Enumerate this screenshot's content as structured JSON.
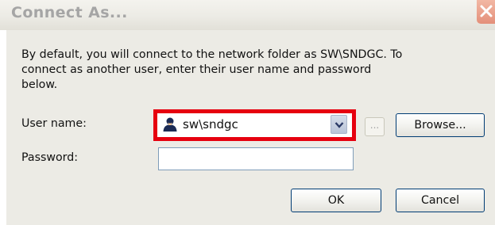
{
  "dialog": {
    "title": "Connect As...",
    "description": "By default, you will connect to the network folder as SW\\SNDGC. To connect as another user, enter their user name and password below."
  },
  "form": {
    "username_label": "User name:",
    "username_value": "sw\\sndgc",
    "username_icon": "user-icon",
    "dots_label": "...",
    "browse_label": "Browse...",
    "password_label": "Password:",
    "password_value": ""
  },
  "buttons": {
    "ok_label": "OK",
    "cancel_label": "Cancel"
  },
  "colors": {
    "highlight": "#e6000f",
    "dialog_bg": "#ecebe5",
    "title_text": "#a5a5a5",
    "button_border": "#003c74"
  }
}
